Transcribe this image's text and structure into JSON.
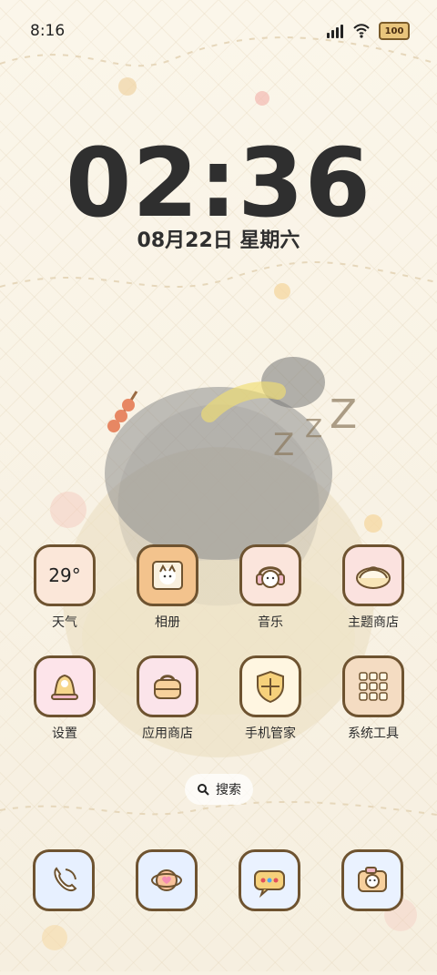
{
  "status_bar": {
    "time": "8:16",
    "battery": "100"
  },
  "lock_widget": {
    "time": "02:36",
    "date": "08月22日 星期六"
  },
  "home_apps_row1": [
    {
      "label": "天气",
      "icon": "weather-icon",
      "icon_text": "29°"
    },
    {
      "label": "相册",
      "icon": "gallery-icon"
    },
    {
      "label": "音乐",
      "icon": "music-icon"
    },
    {
      "label": "主题商店",
      "icon": "theme-store-icon"
    }
  ],
  "home_apps_row2": [
    {
      "label": "设置",
      "icon": "settings-icon"
    },
    {
      "label": "应用商店",
      "icon": "app-store-icon"
    },
    {
      "label": "手机管家",
      "icon": "phone-manager-icon"
    },
    {
      "label": "系统工具",
      "icon": "system-tools-icon"
    }
  ],
  "search": {
    "label": "搜索"
  },
  "dock": [
    {
      "icon": "phone-icon"
    },
    {
      "icon": "browser-icon"
    },
    {
      "icon": "messages-icon"
    },
    {
      "icon": "camera-icon"
    }
  ]
}
